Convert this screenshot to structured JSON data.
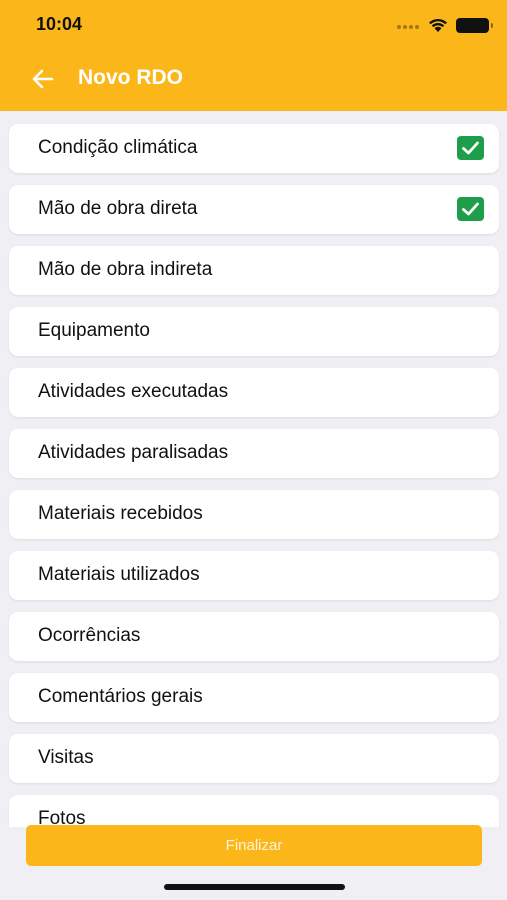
{
  "status_bar": {
    "time": "10:04"
  },
  "nav": {
    "title": "Novo RDO",
    "back_icon": "arrow-left-icon"
  },
  "colors": {
    "accent": "#fbb71a",
    "check": "#1e9e4a",
    "background": "#efeff4"
  },
  "sections": [
    {
      "label": "Condição climática",
      "checked": true
    },
    {
      "label": "Mão de obra direta",
      "checked": true
    },
    {
      "label": "Mão de obra indireta",
      "checked": false
    },
    {
      "label": "Equipamento",
      "checked": false
    },
    {
      "label": "Atividades executadas",
      "checked": false
    },
    {
      "label": "Atividades paralisadas",
      "checked": false
    },
    {
      "label": "Materiais recebidos",
      "checked": false
    },
    {
      "label": "Materiais utilizados",
      "checked": false
    },
    {
      "label": "Ocorrências",
      "checked": false
    },
    {
      "label": "Comentários gerais",
      "checked": false
    },
    {
      "label": "Visitas",
      "checked": false
    },
    {
      "label": "Fotos",
      "checked": false
    }
  ],
  "footer": {
    "finalize_label": "Finalizar"
  }
}
